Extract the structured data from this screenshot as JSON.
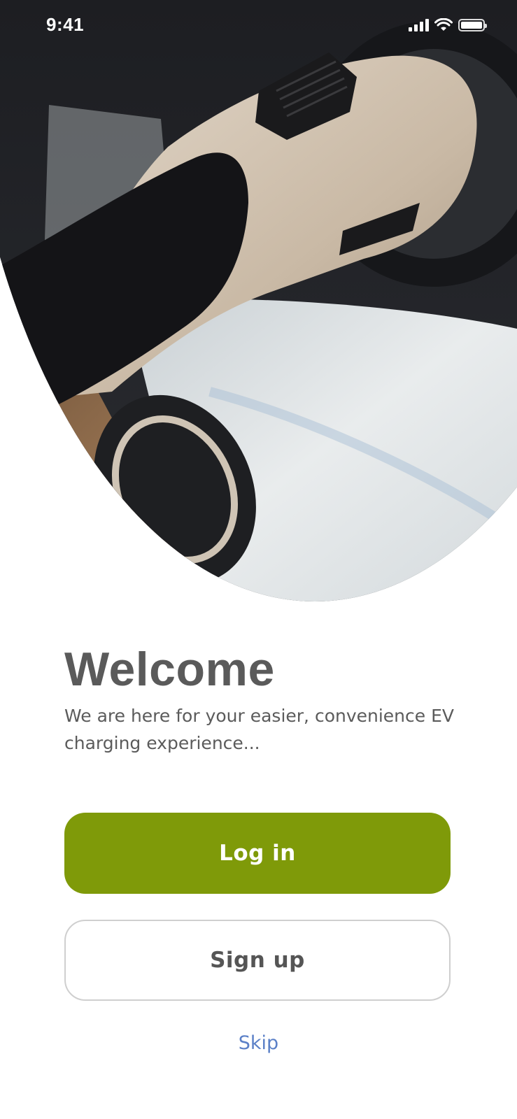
{
  "status_bar": {
    "time": "9:41",
    "icons": [
      "signal-icon",
      "wifi-icon",
      "battery-icon"
    ]
  },
  "hero": {
    "image": "ev-charger-plugged-into-car",
    "colors": {
      "dark": "#1f2024",
      "plug": "#cdbfac",
      "car": "#dfe3e6"
    }
  },
  "welcome": {
    "title": "Welcome",
    "subtitle": "We are here for your easier, convenience EV charging experience..."
  },
  "actions": {
    "login_label": "Log in",
    "signup_label": "Sign up",
    "skip_label": "Skip"
  },
  "colors": {
    "primary": "#7f9a09",
    "link": "#5b80c7",
    "text": "#5a5a5a"
  }
}
